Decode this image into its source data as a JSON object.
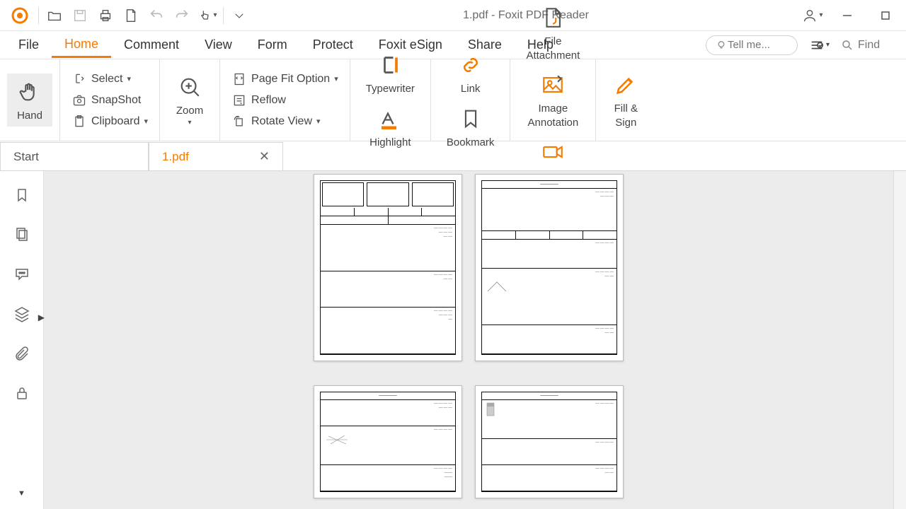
{
  "window": {
    "title": "1.pdf - Foxit PDF Reader"
  },
  "menu": {
    "items": [
      "File",
      "Home",
      "Comment",
      "View",
      "Form",
      "Protect",
      "Foxit eSign",
      "Share",
      "Help"
    ],
    "active": "Home",
    "tell_me_placeholder": "Tell me...",
    "find_placeholder": "Find"
  },
  "ribbon": {
    "hand": "Hand",
    "select": "Select",
    "snapshot": "SnapShot",
    "clipboard": "Clipboard",
    "zoom": "Zoom",
    "page_fit": "Page Fit Option",
    "reflow": "Reflow",
    "rotate": "Rotate View",
    "typewriter": "Typewriter",
    "highlight": "Highlight",
    "link": "Link",
    "bookmark": "Bookmark",
    "file_attach": "File\nAttachment",
    "image_anno": "Image\nAnnotation",
    "audio_video": "Audio\n& Video",
    "fill_sign": "Fill &\nSign"
  },
  "tabs": {
    "start": "Start",
    "active": "1.pdf"
  },
  "colors": {
    "accent": "#f57c00"
  }
}
